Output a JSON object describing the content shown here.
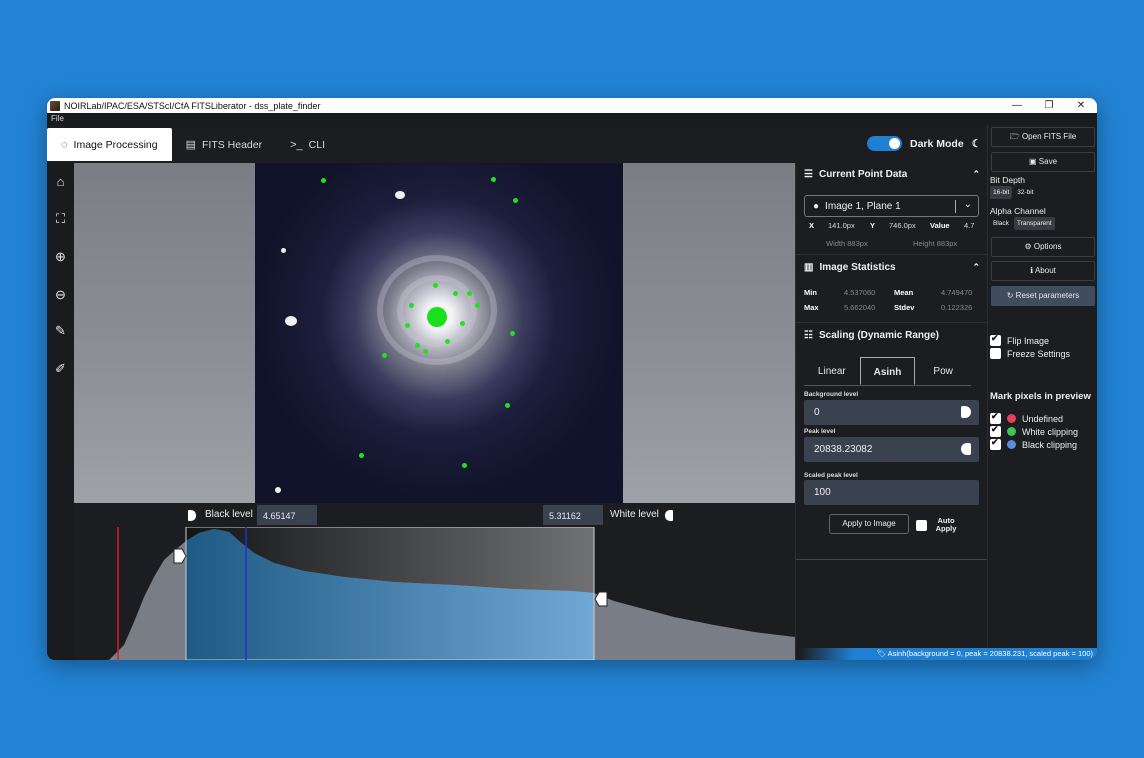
{
  "window": {
    "title": "NOIRLab/IPAC/ESA/STScI/CfA FITSLiberator - dss_plate_finder",
    "controls": [
      "—",
      "❐",
      "✕"
    ]
  },
  "menu": {
    "file": "File"
  },
  "tabs": [
    {
      "label": "Image Processing",
      "icon": "spinner-icon",
      "active": true
    },
    {
      "label": "FITS Header",
      "icon": "list-icon",
      "active": false
    },
    {
      "label": "CLI",
      "icon": "terminal-icon",
      "active": false
    }
  ],
  "dark_mode": {
    "label": "Dark Mode",
    "on": true
  },
  "toolbar": [
    "home-icon",
    "fit-screen-icon",
    "zoom-in-icon",
    "zoom-out-icon",
    "eyedropper-icon",
    "eyedropper-pin-icon"
  ],
  "levels": {
    "black_label": "Black level",
    "black_value": "4.65147",
    "white_label": "White level",
    "white_value": "5.31162"
  },
  "point_data": {
    "title": "Current Point Data",
    "plane": "Image 1, Plane 1",
    "x_label": "X",
    "x_value": "141.0px",
    "y_label": "Y",
    "y_value": "746.0px",
    "value_label": "Value",
    "value_value": "4.7",
    "width": "Width 883px",
    "height": "Height 883px"
  },
  "stats": {
    "title": "Image Statistics",
    "min_label": "Min",
    "min_value": "4.537060",
    "mean_label": "Mean",
    "mean_value": "4.749470",
    "max_label": "Max",
    "max_value": "5.662040",
    "stdev_label": "Stdev",
    "stdev_value": "0.122326"
  },
  "scaling": {
    "title": "Scaling (Dynamic Range)",
    "tabs": [
      "Linear",
      "Asinh",
      "Pow"
    ],
    "active_tab": "Asinh",
    "background_label": "Background level",
    "background_value": "0",
    "peak_label": "Peak level",
    "peak_value": "20838.23082",
    "scaled_peak_label": "Scaled peak level",
    "scaled_peak_value": "100",
    "apply_label": "Apply to Image",
    "auto_apply_label": "Auto Apply"
  },
  "right": {
    "open_label": "Open FITS File",
    "save_label": "Save",
    "bit_depth_label": "Bit Depth",
    "bit_options": [
      "16-bit",
      "32-bit"
    ],
    "alpha_label": "Alpha Channel",
    "alpha_options": [
      "Black",
      "Transparent"
    ],
    "options_label": "Options",
    "about_label": "About",
    "reset_label": "Reset parameters",
    "flip_label": "Flip Image",
    "freeze_label": "Freeze Settings",
    "mark_heading": "Mark pixels in preview",
    "marks": [
      {
        "label": "Undefined",
        "color": "#e8405c",
        "checked": true
      },
      {
        "label": "White clipping",
        "color": "#3fc45a",
        "checked": true
      },
      {
        "label": "Black clipping",
        "color": "#5a8ee0",
        "checked": true
      }
    ]
  },
  "status": {
    "text": "Asinh(background = 0, peak = 20838.231, scaled peak = 100)"
  }
}
